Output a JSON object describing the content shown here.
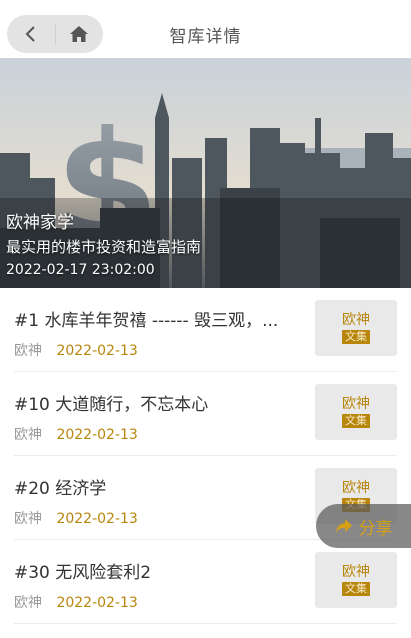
{
  "header": {
    "title": "智库详情",
    "back_icon": "chevron-left-icon",
    "home_icon": "home-icon"
  },
  "banner": {
    "author": "欧神家学",
    "subtitle": "最实用的楼市投资和造富指南",
    "datetime": "2022-02-17 23:02:00"
  },
  "articles": [
    {
      "title": "#1 水库羊年贺禧 ------ 毁三观，...",
      "author": "欧神",
      "date": "2022-02-13",
      "thumb_top": "欧神",
      "thumb_bottom": "文集"
    },
    {
      "title": "#10 大道随行，不忘本心",
      "author": "欧神",
      "date": "2022-02-13",
      "thumb_top": "欧神",
      "thumb_bottom": "文集"
    },
    {
      "title": "#20 经济学",
      "author": "欧神",
      "date": "2022-02-13",
      "thumb_top": "欧神",
      "thumb_bottom": "文集"
    },
    {
      "title": "#30 无风险套利2",
      "author": "欧神",
      "date": "2022-02-13",
      "thumb_top": "欧神",
      "thumb_bottom": "文集"
    }
  ],
  "share": {
    "label": "分享",
    "icon": "share-arrow-icon"
  },
  "colors": {
    "accent_gold": "#b8860b",
    "share_gold": "#d4a017"
  }
}
